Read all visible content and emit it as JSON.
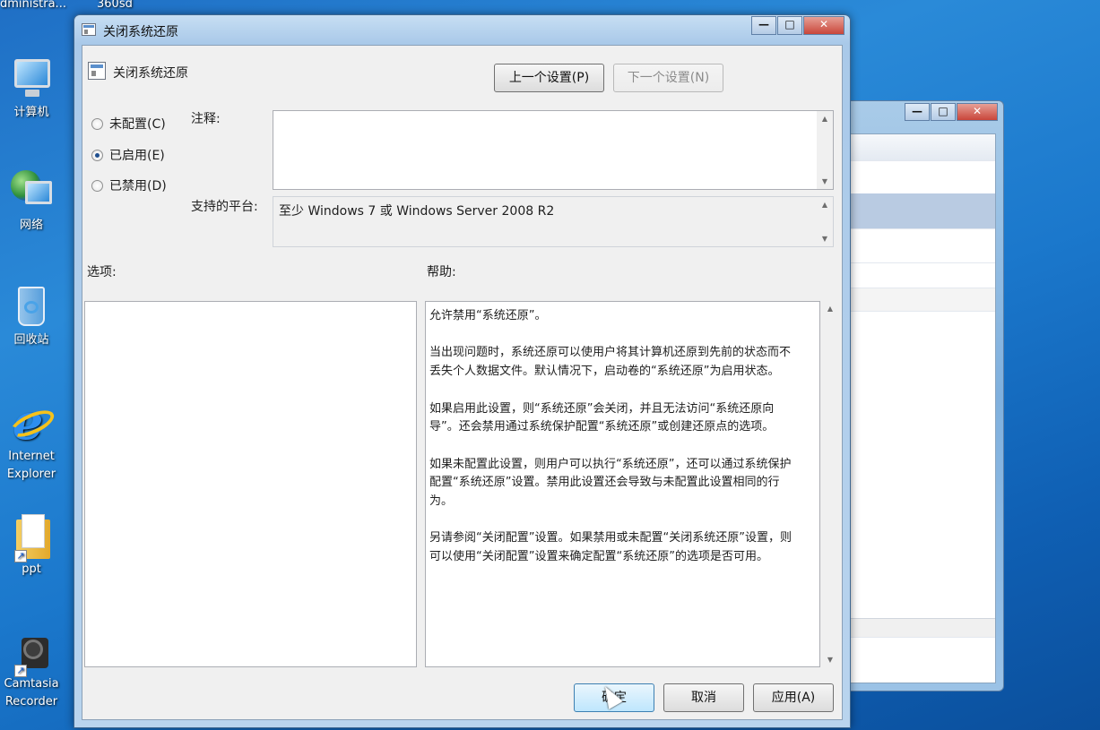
{
  "desktop": {
    "top_files": [
      "dministra...",
      "360sd"
    ],
    "icons": [
      {
        "label": "计算机",
        "icon": "computer-icon"
      },
      {
        "label": "网络",
        "icon": "network-icon"
      },
      {
        "label": "回收站",
        "icon": "recycle-bin-icon"
      },
      {
        "label": "Internet Explorer",
        "icon": "internet-explorer-icon"
      },
      {
        "label": "ppt",
        "icon": "folder-icon"
      },
      {
        "label": "Camtasia Recorder",
        "icon": "camtasia-recorder-icon"
      }
    ]
  },
  "background_window": {
    "caption_buttons": {
      "minimize": "—",
      "maximize": "□",
      "close": "✕"
    }
  },
  "dialog": {
    "title": "关闭系统还原",
    "caption_buttons": {
      "minimize": "—",
      "maximize": "□",
      "close": "✕"
    },
    "policy_name": "关闭系统还原",
    "prev_button": "上一个设置(P)",
    "next_button": "下一个设置(N)",
    "radio_options": [
      {
        "label": "未配置(C)",
        "selected": false
      },
      {
        "label": "已启用(E)",
        "selected": true
      },
      {
        "label": "已禁用(D)",
        "selected": false
      }
    ],
    "comment_label": "注释:",
    "comment_value": "",
    "platform_label": "支持的平台:",
    "platform_value": "至少 Windows 7 或 Windows Server 2008 R2",
    "options_label": "选项:",
    "help_label": "帮助:",
    "help_text": "允许禁用“系统还原”。\n\n当出现问题时，系统还原可以使用户将其计算机还原到先前的状态而不丢失个人数据文件。默认情况下，启动卷的“系统还原”为启用状态。\n\n如果启用此设置，则“系统还原”会关闭，并且无法访问“系统还原向导”。还会禁用通过系统保护配置“系统还原”或创建还原点的选项。\n\n如果未配置此设置，则用户可以执行“系统还原”，还可以通过系统保护配置“系统还原”设置。禁用此设置还会导致与未配置此设置相同的行为。\n\n另请参阅“关闭配置”设置。如果禁用或未配置“关闭系统还原”设置，则可以使用“关闭配置”设置来确定配置“系统还原”的选项是否可用。",
    "ok_button": "确定",
    "cancel_button": "取消",
    "apply_button": "应用(A)"
  }
}
